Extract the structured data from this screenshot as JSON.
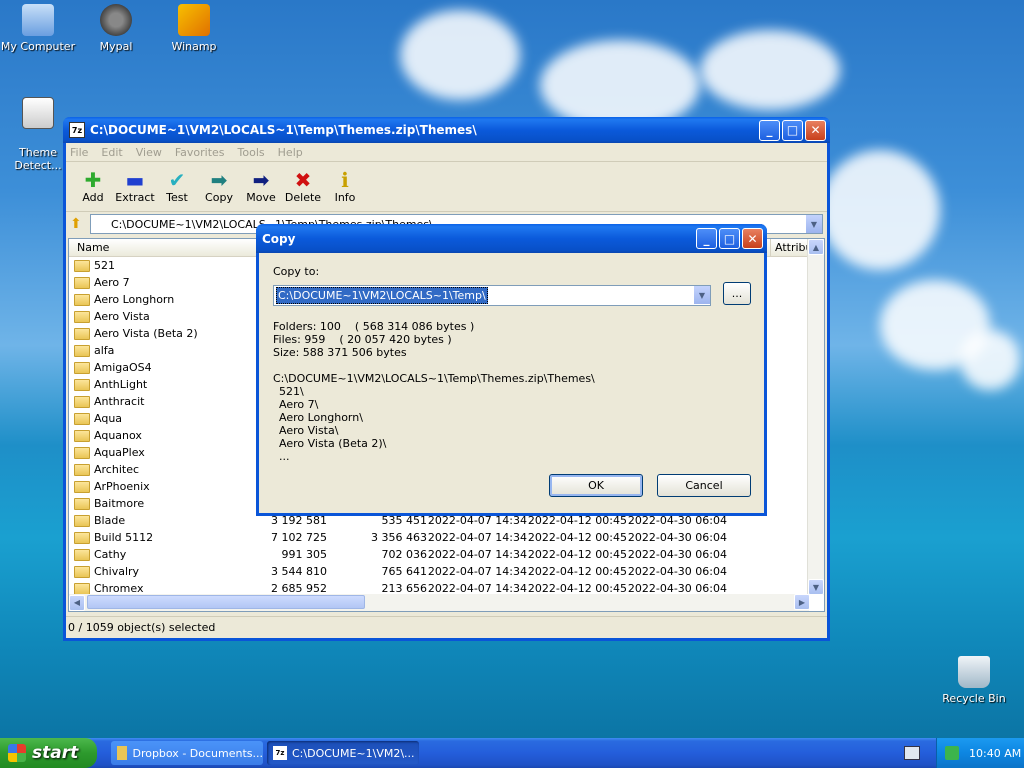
{
  "desktop": {
    "icons": [
      {
        "label": "My Computer"
      },
      {
        "label": "Mypal"
      },
      {
        "label": "Winamp"
      },
      {
        "label": "Theme\nDetect..."
      },
      {
        "label": "Recycle Bin"
      }
    ]
  },
  "window": {
    "title": "C:\\DOCUME~1\\VM2\\LOCALS~1\\Temp\\Themes.zip\\Themes\\",
    "app_icon": "7z",
    "menu": [
      "File",
      "Edit",
      "View",
      "Favorites",
      "Tools",
      "Help"
    ],
    "toolbar": [
      {
        "label": "Add",
        "icon": "plus-icon",
        "color": "#2eaa2e"
      },
      {
        "label": "Extract",
        "icon": "minus-icon",
        "color": "#1f3fd0"
      },
      {
        "label": "Test",
        "icon": "check-icon",
        "color": "#28b0c0"
      },
      {
        "label": "Copy",
        "icon": "copy-arrow-icon",
        "color": "#208080"
      },
      {
        "label": "Move",
        "icon": "move-arrow-icon",
        "color": "#102080"
      },
      {
        "label": "Delete",
        "icon": "x-icon",
        "color": "#d01010"
      },
      {
        "label": "Info",
        "icon": "info-icon",
        "color": "#c8a000"
      }
    ],
    "address": "C:\\DOCUME~1\\VM2\\LOCALS~1\\Temp\\Themes.zip\\Themes\\",
    "columns": {
      "name": "Name",
      "attributes": "Attribu"
    },
    "rows": [
      {
        "name": "521"
      },
      {
        "name": "Aero 7"
      },
      {
        "name": "Aero Longhorn"
      },
      {
        "name": "Aero Vista"
      },
      {
        "name": "Aero Vista (Beta 2)"
      },
      {
        "name": "alfa"
      },
      {
        "name": "AmigaOS4"
      },
      {
        "name": "AnthLight"
      },
      {
        "name": "Anthracit"
      },
      {
        "name": "Aqua"
      },
      {
        "name": "Aquanox"
      },
      {
        "name": "AquaPlex"
      },
      {
        "name": "Architec"
      },
      {
        "name": "ArPhoenix"
      },
      {
        "name": "Baitmore"
      },
      {
        "name": "Blade",
        "size": "3 192 581",
        "packed": "535 451",
        "modified": "2022-04-07 14:34",
        "created": "2022-04-12 00:45",
        "accessed": "2022-04-30 06:04"
      },
      {
        "name": "Build 5112",
        "size": "7 102 725",
        "packed": "3 356 463",
        "modified": "2022-04-07 14:34",
        "created": "2022-04-12 00:45",
        "accessed": "2022-04-30 06:04"
      },
      {
        "name": "Cathy",
        "size": "991 305",
        "packed": "702 036",
        "modified": "2022-04-07 14:34",
        "created": "2022-04-12 00:45",
        "accessed": "2022-04-30 06:04"
      },
      {
        "name": "Chivalry",
        "size": "3 544 810",
        "packed": "765 641",
        "modified": "2022-04-07 14:34",
        "created": "2022-04-12 00:45",
        "accessed": "2022-04-30 06:04"
      },
      {
        "name": "Chromex",
        "size": "2 685 952",
        "packed": "213 656",
        "modified": "2022-04-07 14:34",
        "created": "2022-04-12 00:45",
        "accessed": "2022-04-30 06:04"
      }
    ],
    "status": "0 / 1059 object(s) selected"
  },
  "dialog": {
    "title": "Copy",
    "copy_to_label": "Copy to:",
    "path": "C:\\DOCUME~1\\VM2\\LOCALS~1\\Temp\\",
    "browse_label": "...",
    "folders": "Folders: 100    ( 568 314 086 bytes )",
    "files": "Files: 959    ( 20 057 420 bytes )",
    "size": "Size: 588 371 506 bytes",
    "source": "C:\\DOCUME~1\\VM2\\LOCALS~1\\Temp\\Themes.zip\\Themes\\",
    "items": [
      "521\\",
      "Aero 7\\",
      "Aero Longhorn\\",
      "Aero Vista\\",
      "Aero Vista (Beta 2)\\",
      "..."
    ],
    "ok": "OK",
    "cancel": "Cancel"
  },
  "taskbar": {
    "start": "start",
    "tasks": [
      {
        "label": "Dropbox - Documents...",
        "active": false
      },
      {
        "label": "C:\\DOCUME~1\\VM2\\...",
        "active": true,
        "icon": "7z"
      }
    ],
    "clock": "10:40 AM"
  }
}
